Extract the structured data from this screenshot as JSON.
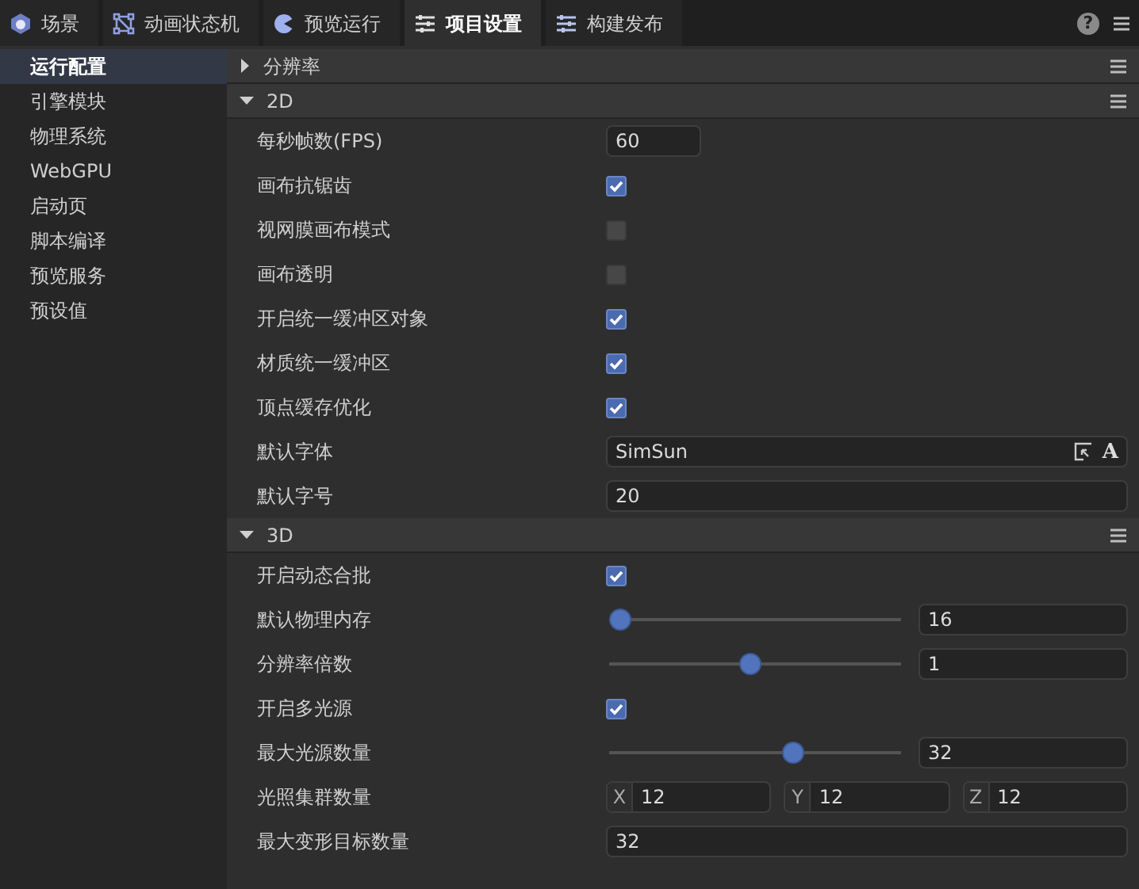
{
  "tabs": [
    {
      "label": "场景",
      "selected": false
    },
    {
      "label": "动画状态机",
      "selected": false
    },
    {
      "label": "预览运行",
      "selected": false
    },
    {
      "label": "项目设置",
      "selected": true
    },
    {
      "label": "构建发布",
      "selected": false
    }
  ],
  "help_button": "?",
  "sidebar": {
    "items": [
      {
        "label": "运行配置",
        "selected": true
      },
      {
        "label": "引擎模块",
        "selected": false
      },
      {
        "label": "物理系统",
        "selected": false
      },
      {
        "label": "WebGPU",
        "selected": false
      },
      {
        "label": "启动页",
        "selected": false
      },
      {
        "label": "脚本编译",
        "selected": false
      },
      {
        "label": "预览服务",
        "selected": false
      },
      {
        "label": "预设值",
        "selected": false
      }
    ]
  },
  "sections": [
    {
      "title": "分辨率",
      "expanded": false
    },
    {
      "title": "2D",
      "expanded": true,
      "rows": [
        {
          "kind": "short_text",
          "label": "每秒帧数(FPS)",
          "value": "60"
        },
        {
          "kind": "checkbox",
          "label": "画布抗锯齿",
          "checked": true
        },
        {
          "kind": "checkbox",
          "label": "视网膜画布模式",
          "checked": false
        },
        {
          "kind": "checkbox",
          "label": "画布透明",
          "checked": false
        },
        {
          "kind": "checkbox",
          "label": "开启统一缓冲区对象",
          "checked": true
        },
        {
          "kind": "checkbox",
          "label": "材质统一缓冲区",
          "checked": true
        },
        {
          "kind": "checkbox",
          "label": "顶点缓存优化",
          "checked": true
        },
        {
          "kind": "font",
          "label": "默认字体",
          "value": "SimSun",
          "font_button": "A"
        },
        {
          "kind": "text",
          "label": "默认字号",
          "value": "20"
        }
      ]
    },
    {
      "title": "3D",
      "expanded": true,
      "rows": [
        {
          "kind": "checkbox",
          "label": "开启动态合批",
          "checked": true
        },
        {
          "kind": "slider",
          "label": "默认物理内存",
          "level": 0,
          "value": "16"
        },
        {
          "kind": "slider",
          "label": "分辨率倍数",
          "level": 0.48,
          "value": "1"
        },
        {
          "kind": "checkbox",
          "label": "开启多光源",
          "checked": true
        },
        {
          "kind": "slider",
          "label": "最大光源数量",
          "level": 0.64,
          "value": "32"
        },
        {
          "kind": "xyz",
          "label": "光照集群数量",
          "parts": [
            {
              "axis": "X",
              "value": "12"
            },
            {
              "axis": "Y",
              "value": "12"
            },
            {
              "axis": "Z",
              "value": "12"
            }
          ]
        },
        {
          "kind": "text",
          "label": "最大变形目标数量",
          "value": "32"
        }
      ]
    }
  ]
}
